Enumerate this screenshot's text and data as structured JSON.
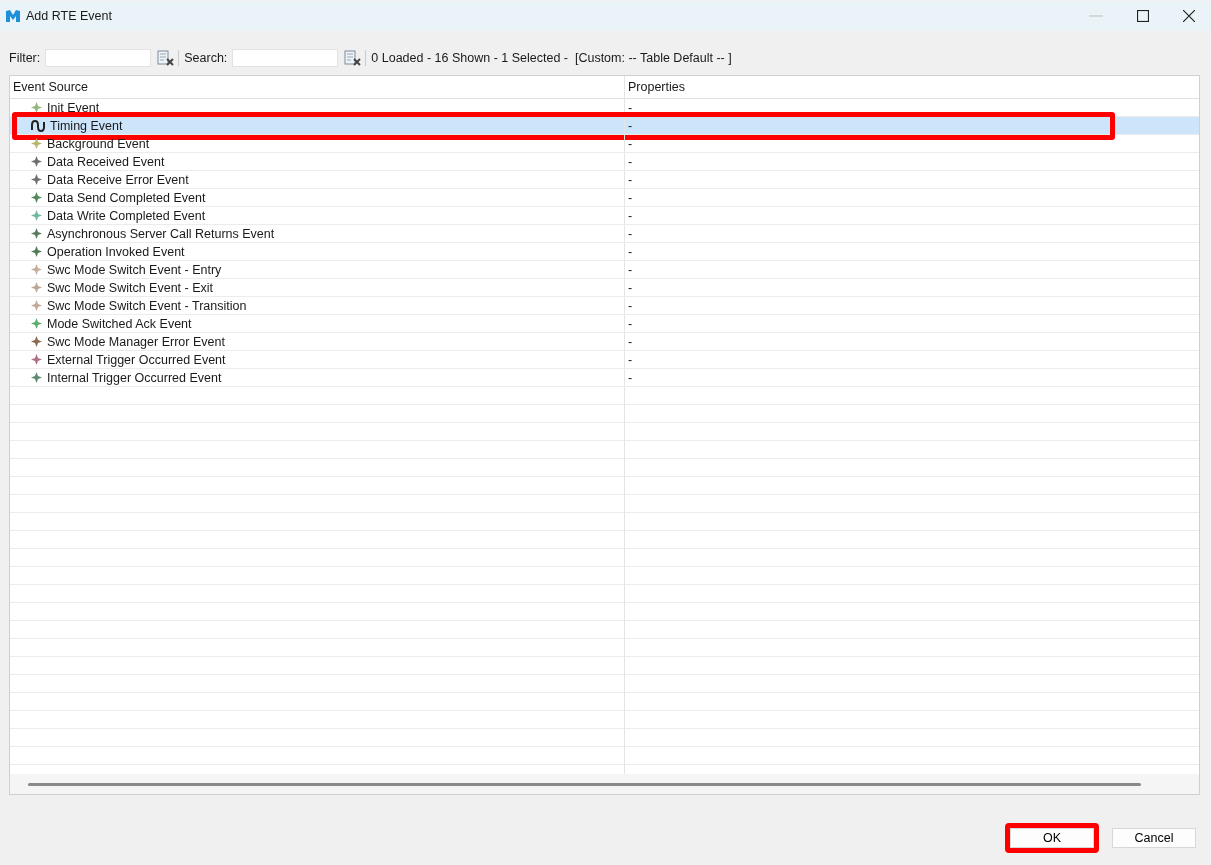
{
  "window": {
    "title": "Add RTE Event"
  },
  "toolbar": {
    "filter_label": "Filter:",
    "search_label": "Search:",
    "status": "0 Loaded - 16 Shown - 1 Selected -  [Custom: -- Table Default -- ]"
  },
  "table": {
    "columns": [
      "Event Source",
      "Properties"
    ],
    "rows": [
      {
        "name": "Init Event",
        "properties": "-",
        "kind": "event",
        "color": "#8fb87a",
        "selected": false,
        "annotated": false
      },
      {
        "name": "Timing Event",
        "properties": "-",
        "kind": "timing",
        "color": "#222222",
        "selected": true,
        "annotated": true
      },
      {
        "name": "Background Event",
        "properties": "-",
        "kind": "event",
        "color": "#b8b46a",
        "selected": false,
        "annotated": false
      },
      {
        "name": "Data Received Event",
        "properties": "-",
        "kind": "event",
        "color": "#6e6e6e",
        "selected": false,
        "annotated": false
      },
      {
        "name": "Data Receive Error Event",
        "properties": "-",
        "kind": "event",
        "color": "#707070",
        "selected": false,
        "annotated": false
      },
      {
        "name": "Data Send Completed Event",
        "properties": "-",
        "kind": "event",
        "color": "#4f8a5c",
        "selected": false,
        "annotated": false
      },
      {
        "name": "Data Write Completed Event",
        "properties": "-",
        "kind": "event",
        "color": "#6fb89a",
        "selected": false,
        "annotated": false
      },
      {
        "name": "Asynchronous Server Call Returns Event",
        "properties": "-",
        "kind": "event",
        "color": "#5a7a5e",
        "selected": false,
        "annotated": false
      },
      {
        "name": "Operation Invoked Event",
        "properties": "-",
        "kind": "event",
        "color": "#4e7d58",
        "selected": false,
        "annotated": false
      },
      {
        "name": "Swc Mode Switch Event - Entry",
        "properties": "-",
        "kind": "event",
        "color": "#c4ad9c",
        "selected": false,
        "annotated": false
      },
      {
        "name": "Swc Mode Switch Event - Exit",
        "properties": "-",
        "kind": "event",
        "color": "#bca696",
        "selected": false,
        "annotated": false
      },
      {
        "name": "Swc Mode Switch Event - Transition",
        "properties": "-",
        "kind": "event",
        "color": "#c2aa9a",
        "selected": false,
        "annotated": false
      },
      {
        "name": "Mode Switched Ack Event",
        "properties": "-",
        "kind": "event",
        "color": "#5cae6e",
        "selected": false,
        "annotated": false
      },
      {
        "name": "Swc Mode Manager Error Event",
        "properties": "-",
        "kind": "event",
        "color": "#8a6a52",
        "selected": false,
        "annotated": false
      },
      {
        "name": "External Trigger Occurred Event",
        "properties": "-",
        "kind": "event",
        "color": "#b0708a",
        "selected": false,
        "annotated": false
      },
      {
        "name": "Internal Trigger Occurred Event",
        "properties": "-",
        "kind": "event",
        "color": "#5e8a74",
        "selected": false,
        "annotated": false
      }
    ]
  },
  "buttons": [
    {
      "label": "OK",
      "annotated": true
    },
    {
      "label": "Cancel",
      "annotated": false
    }
  ]
}
